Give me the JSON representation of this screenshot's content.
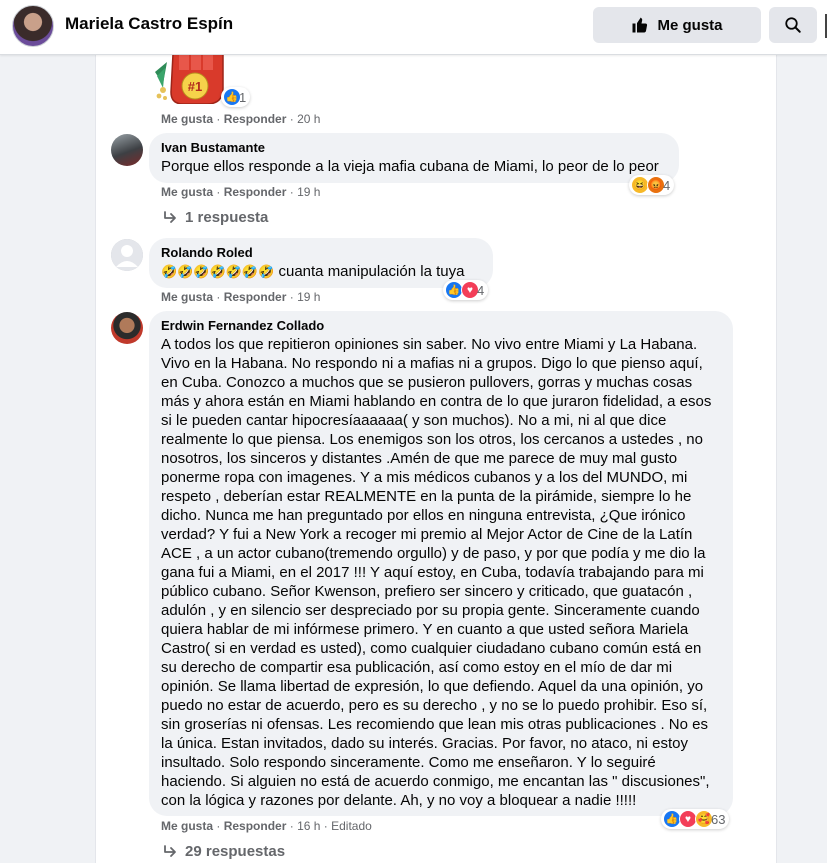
{
  "header": {
    "page_name": "Mariela Castro Espín",
    "like_label": "Me gusta"
  },
  "actions": {
    "like": "Me gusta",
    "reply": "Responder",
    "sep": "·",
    "edited": "Editado"
  },
  "comments": [
    {
      "sticker_text": "#1",
      "reaction_count": "1",
      "time": "20 h"
    },
    {
      "author": "Ivan Bustamante",
      "text": "Porque ellos responde a la vieja mafia cubana de Miami, lo peor de lo peor",
      "reaction_count": "4",
      "time": "19 h",
      "replies_label": "1 respuesta"
    },
    {
      "author": "Rolando Roled",
      "emoji": "🤣🤣🤣🤣🤣🤣🤣",
      "text": "cuanta manipulación la tuya",
      "reaction_count": "4",
      "time": "19 h"
    },
    {
      "author": "Erdwin Fernandez Collado",
      "text": "A todos los que repitieron opiniones sin saber. No vivo entre Miami y La Habana. Vivo en la Habana. No respondo ni a mafias ni a grupos. Digo lo que pienso aquí, en Cuba. Conozco a muchos que se pusieron pullovers, gorras y muchas cosas más y ahora están en Miami hablando en contra de lo que juraron fidelidad, a esos si le pueden cantar hipocresíaaaaaa( y son muchos). No a mi, ni al que dice realmente lo que piensa. Los enemigos son los otros, los cercanos a ustedes , no nosotros, los sinceros y distantes .Amén de que me parece de muy mal gusto ponerme ropa con imagenes. Y a mis médicos cubanos y a los del MUNDO, mi respeto , deberían estar REALMENTE en la punta de la pirámide, siempre lo he dicho. Nunca me han preguntado por ellos en ninguna entrevista, ¿Que irónico verdad? Y fui a New York a recoger mi premio al Mejor Actor de Cine de la Latín ACE , a un actor cubano(tremendo orgullo) y de paso, y por que podía y me dio la gana fui a Miami, en el 2017 !!! Y aquí estoy, en Cuba, todavía trabajando para mi público cubano. Señor Kwenson, prefiero ser sincero y criticado, que guatacón , adulón , y en silencio ser despreciado por su propia gente. Sinceramente cuando quiera hablar de mi infórmese primero. Y en cuanto a que usted señora Mariela Castro( si en verdad es usted), como cualquier ciudadano cubano común está en su derecho de compartir esa publicación, así como estoy en el mío de dar mi opinión. Se llama libertad de expresión, lo que defiendo. Aquel da una opinión, yo puedo no estar de acuerdo, pero es su derecho , y no se lo puedo prohibir. Eso sí, sin groserías ni ofensas. Les recomiendo que lean mis otras publicaciones . No es la única. Estan invitados, dado su interés. Gracias. Por favor, no ataco, ni estoy insultado. Solo respondo sinceramente. Como me enseñaron. Y lo seguiré haciendo. Si alguien no está de acuerdo conmigo, me encantan las \" discusiones\", con la lógica y razones por delante. Ah, y no voy a bloquear a nadie !!!!!",
      "reaction_count": "63",
      "time": "16 h",
      "replies_label": "29 respuestas"
    }
  ],
  "colors": {
    "like_blue": "#1877f2",
    "bubble_bg": "#f0f2f5",
    "meta_gray": "#65676b"
  }
}
